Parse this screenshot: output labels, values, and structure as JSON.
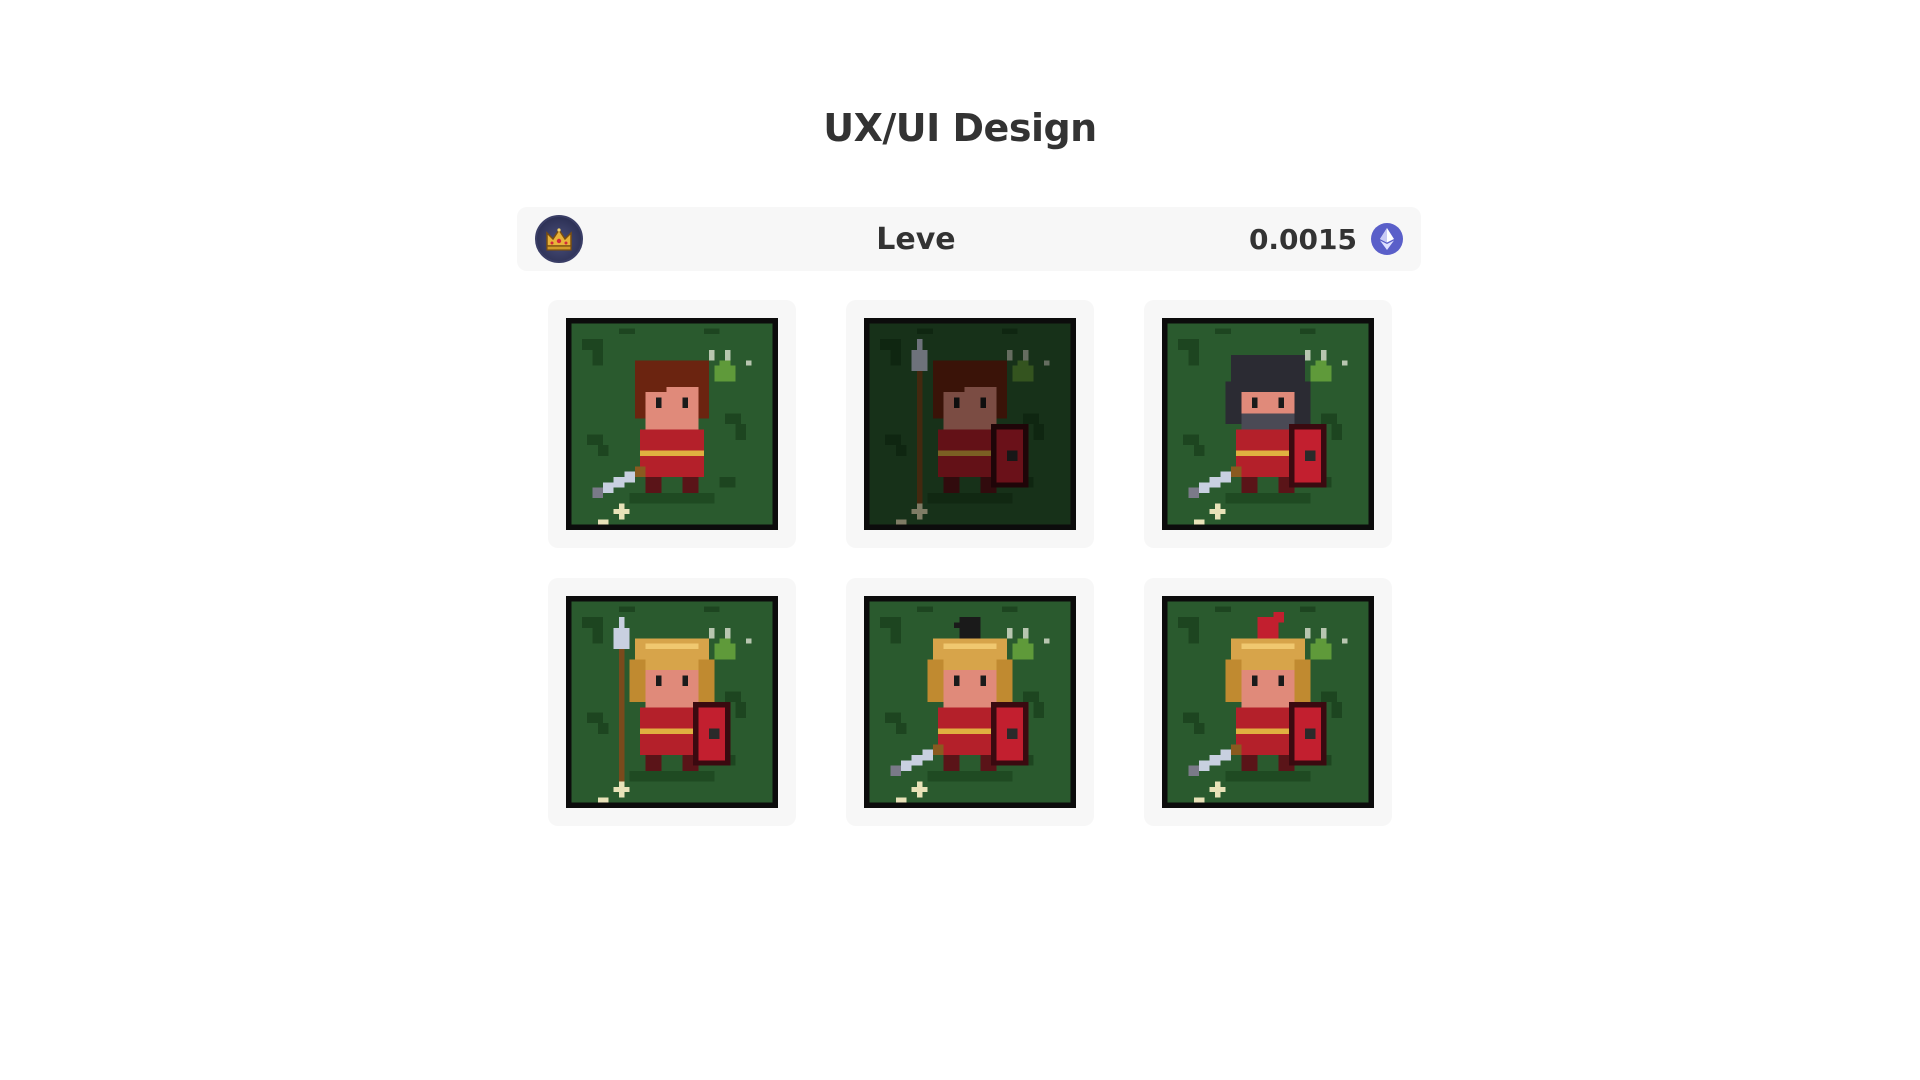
{
  "page": {
    "title": "UX/UI Design"
  },
  "header": {
    "avatar_icon": "crown-icon",
    "user_name": "Leve",
    "price": "0.0015",
    "currency_icon": "ethereum-icon",
    "currency_color": "#5a5fc9"
  },
  "nfts": [
    {
      "id": "warrior-1",
      "hair": "#6b2410",
      "helmet": "none",
      "weapon": "sword",
      "shield": false,
      "dim": false
    },
    {
      "id": "warrior-2",
      "hair": "#6b2410",
      "helmet": "none",
      "weapon": "spear",
      "shield": true,
      "dim": true
    },
    {
      "id": "warrior-3",
      "hair": "#6b2410",
      "helmet": "dark",
      "weapon": "sword",
      "shield": true,
      "dim": false
    },
    {
      "id": "warrior-4",
      "hair": "#b88a3a",
      "helmet": "gold",
      "weapon": "spear",
      "shield": true,
      "dim": false
    },
    {
      "id": "warrior-5",
      "hair": "#b88a3a",
      "helmet": "gold-black-crest",
      "weapon": "sword",
      "shield": true,
      "dim": false
    },
    {
      "id": "warrior-6",
      "hair": "#b88a3a",
      "helmet": "gold-red-crest",
      "weapon": "sword",
      "shield": true,
      "dim": false
    }
  ],
  "colors": {
    "card_bg": "#f7f7f7",
    "grass": "#2a5a2e",
    "armor": "#b4202a",
    "shield": "#c21f2f"
  }
}
